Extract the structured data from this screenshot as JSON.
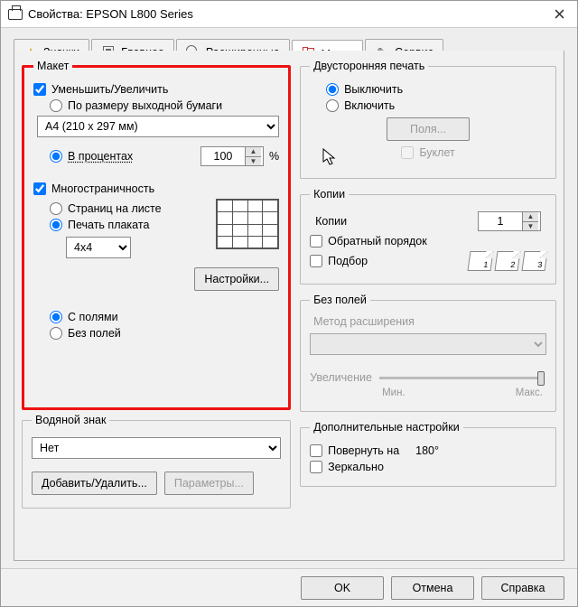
{
  "window": {
    "title": "Свойства: EPSON L800 Series"
  },
  "tabs": {
    "znachki": "Значки",
    "glavnoe": "Главное",
    "rassh": "Расширенные",
    "maket": "Макет",
    "servis": "Сервис"
  },
  "maket": {
    "legend": "Макет",
    "reduce_enlarge": "Уменьшить/Увеличить",
    "fit_output": "По размеру выходной бумаги",
    "paper_size": "A4 (210 x 297 мм)",
    "percent_lbl": "В процентах",
    "percent_val": "100",
    "percent_sym": "%",
    "multipage": "Многостраничность",
    "pages_per_sheet": "Страниц на листе",
    "poster": "Печать плаката",
    "poster_size": "4x4",
    "settings_btn": "Настройки...",
    "with_margins": "С полями",
    "borderless": "Без полей"
  },
  "watermark": {
    "legend": "Водяной знак",
    "none": "Нет",
    "add_del": "Добавить/Удалить...",
    "params": "Параметры..."
  },
  "duplex": {
    "legend": "Двусторонняя печать",
    "off": "Выключить",
    "on": "Включить",
    "margins_btn": "Поля...",
    "booklet": "Буклет"
  },
  "copies": {
    "legend": "Копии",
    "label": "Копии",
    "value": "1",
    "reverse": "Обратный порядок",
    "collate": "Подбор",
    "p1": "1",
    "p2": "2",
    "p3": "3"
  },
  "borderless_right": {
    "legend": "Без полей",
    "method": "Метод расширения",
    "enlarge": "Увеличение",
    "min": "Мин.",
    "max": "Макс."
  },
  "extra": {
    "legend": "Дополнительные настройки",
    "rotate": "Повернуть на",
    "rotate_deg": "180°",
    "mirror": "Зеркально"
  },
  "buttons": {
    "ok": "OK",
    "cancel": "Отмена",
    "help": "Справка"
  }
}
